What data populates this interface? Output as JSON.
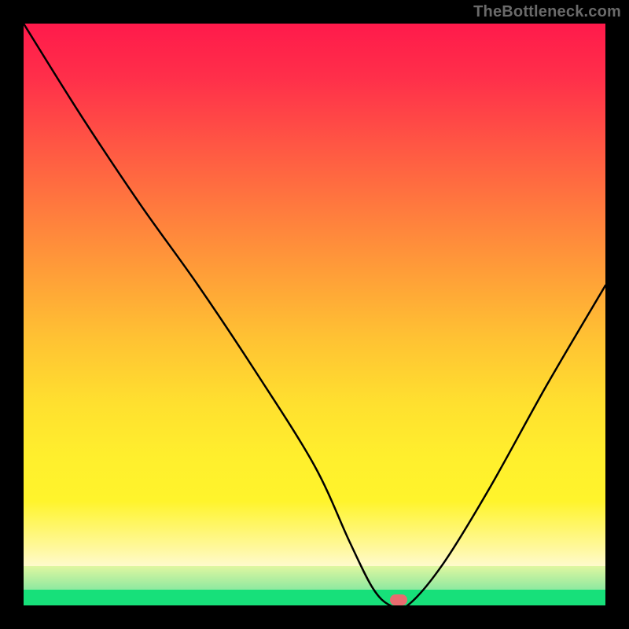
{
  "watermark": "TheBottleneck.com",
  "colors": {
    "frame_bg": "#000000",
    "gradient_top": "#ff1a4b",
    "gradient_mid": "#ffc233",
    "gradient_low": "#fff42c",
    "green_band": "#17e07a",
    "curve": "#000000",
    "marker": "#e86b6f",
    "watermark_text": "#6a6a6a"
  },
  "chart_data": {
    "type": "line",
    "title": "",
    "xlabel": "",
    "ylabel": "",
    "xlim": [
      0,
      100
    ],
    "ylim": [
      0,
      100
    ],
    "series": [
      {
        "name": "bottleneck-curve",
        "x": [
          0,
          10,
          20,
          30,
          40,
          50,
          56,
          60,
          63,
          66,
          72,
          80,
          90,
          100
        ],
        "values": [
          100,
          84,
          69,
          55,
          40,
          24,
          11,
          3,
          0,
          0,
          7,
          20,
          38,
          55
        ]
      }
    ],
    "marker": {
      "x": 64.5,
      "y": 1
    },
    "notes": "Values read from pixel positions; x and y normalised 0–100. Curve falls from top-left to a flat minimum near x≈63–66 then rises toward upper-right."
  }
}
